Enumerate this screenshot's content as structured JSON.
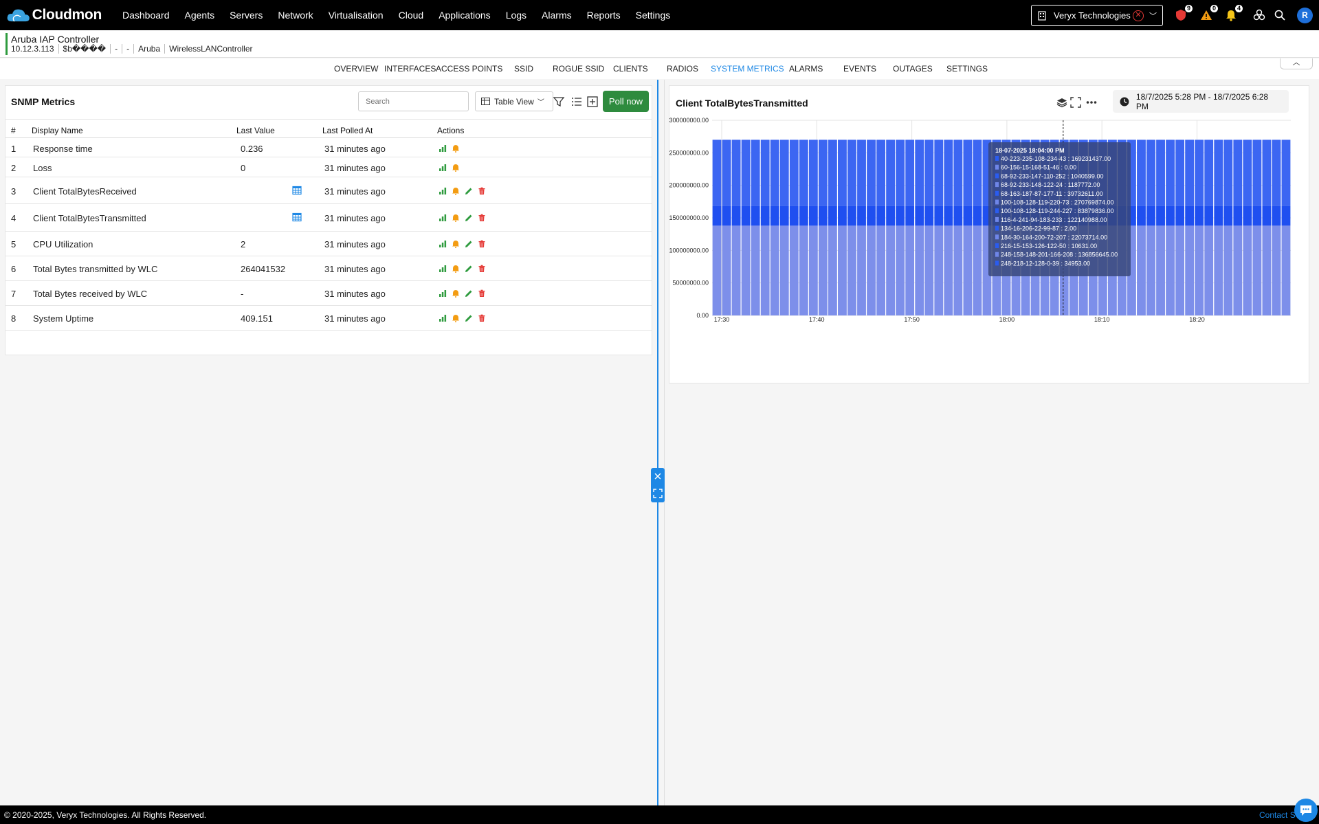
{
  "app": {
    "brand": "Cloudmon",
    "menu": [
      "Dashboard",
      "Agents",
      "Servers",
      "Network",
      "Virtualisation",
      "Cloud",
      "Applications",
      "Logs",
      "Alarms",
      "Reports",
      "Settings"
    ],
    "org": "Veryx Technologies",
    "badges": {
      "critical": "9",
      "warning": "0",
      "notifications": "4"
    },
    "avatar": "R"
  },
  "device": {
    "title": "Aruba IAP Controller",
    "ip": "10.12.3.113",
    "location": "$b����",
    "field3": "-",
    "field4": "-",
    "vendor": "Aruba",
    "type": "WirelessLANController"
  },
  "tabs": [
    "OVERVIEW",
    "INTERFACES",
    "ACCESS POINTS",
    "SSID",
    "ROGUE SSID",
    "CLIENTS",
    "RADIOS",
    "SYSTEM METRICS",
    "ALARMS",
    "EVENTS",
    "OUTAGES",
    "SETTINGS"
  ],
  "active_tab": "SYSTEM METRICS",
  "snmp": {
    "title": "SNMP Metrics",
    "search_placeholder": "Search",
    "view": "Table View",
    "poll_label": "Poll now",
    "columns": [
      "#",
      "Display Name",
      "Last Value",
      "Last Polled At",
      "Actions"
    ],
    "rows": [
      {
        "n": "1",
        "name": "Response time",
        "value": "0.236",
        "polled": "31 minutes ago",
        "table": false,
        "full": false
      },
      {
        "n": "2",
        "name": "Loss",
        "value": "0",
        "polled": "31 minutes ago",
        "table": false,
        "full": false
      },
      {
        "n": "3",
        "name": "Client TotalBytesReceived",
        "value": "",
        "polled": "31 minutes ago",
        "table": true,
        "full": true
      },
      {
        "n": "4",
        "name": "Client TotalBytesTransmitted",
        "value": "",
        "polled": "31 minutes ago",
        "table": true,
        "full": true
      },
      {
        "n": "5",
        "name": "CPU Utilization",
        "value": "2",
        "polled": "31 minutes ago",
        "table": false,
        "full": true
      },
      {
        "n": "6",
        "name": "Total Bytes transmitted by WLC",
        "value": "264041532",
        "polled": "31 minutes ago",
        "table": false,
        "full": true
      },
      {
        "n": "7",
        "name": "Total Bytes received by WLC",
        "value": "-",
        "polled": "31 minutes ago",
        "table": false,
        "full": true
      },
      {
        "n": "8",
        "name": "System Uptime",
        "value": "409.151",
        "polled": "31 minutes ago",
        "table": false,
        "full": true
      }
    ]
  },
  "chart_panel": {
    "title": "Client TotalBytesTransmitted",
    "date_range": "18/7/2025 5:28 PM - 18/7/2025 6:28 PM"
  },
  "chart_data": {
    "type": "bar",
    "stacked": true,
    "y_ticks": [
      "300000000.00",
      "250000000.00",
      "200000000.00",
      "150000000.00",
      "100000000.00",
      "50000000.00",
      "0.00"
    ],
    "ylim": [
      0,
      300000000
    ],
    "x_ticks": [
      "17:30",
      "17:40",
      "17:50",
      "18:00",
      "18:10",
      "18:20"
    ],
    "bar_count": 60,
    "series_levels": [
      {
        "from": 0,
        "to": 138000000,
        "color": "#7d8fea"
      },
      {
        "from": 138000000,
        "to": 168000000,
        "color": "#1f4ff0"
      },
      {
        "from": 168000000,
        "to": 270000000,
        "color": "#3c66f2"
      }
    ],
    "tooltip": {
      "title": "18-07-2025 18:04:00 PM",
      "items": [
        "40-223-235-108-234-43 : 169231437.00",
        "60-156-15-168-51-46 : 0.00",
        "68-92-233-147-110-252 : 1040599.00",
        "68-92-233-148-122-24 : 1187772.00",
        "68-163-187-87-177-11 : 39732611.00",
        "100-108-128-119-220-73 : 270769874.00",
        "100-108-128-119-244-227 : 83879836.00",
        "116-4-241-94-183-233 : 122140988.00",
        "134-16-206-22-99-87 : 2.00",
        "184-30-164-200-72-207 : 22073714.00",
        "216-15-153-126-122-50 : 10631.00",
        "248-158-148-201-166-208 : 136856645.00",
        "248-218-12-128-0-39 : 34953.00"
      ]
    }
  },
  "footer": {
    "copyright": "© 2020-2025, Veryx Technologies. All Rights Reserved.",
    "contact": "Contact S"
  }
}
